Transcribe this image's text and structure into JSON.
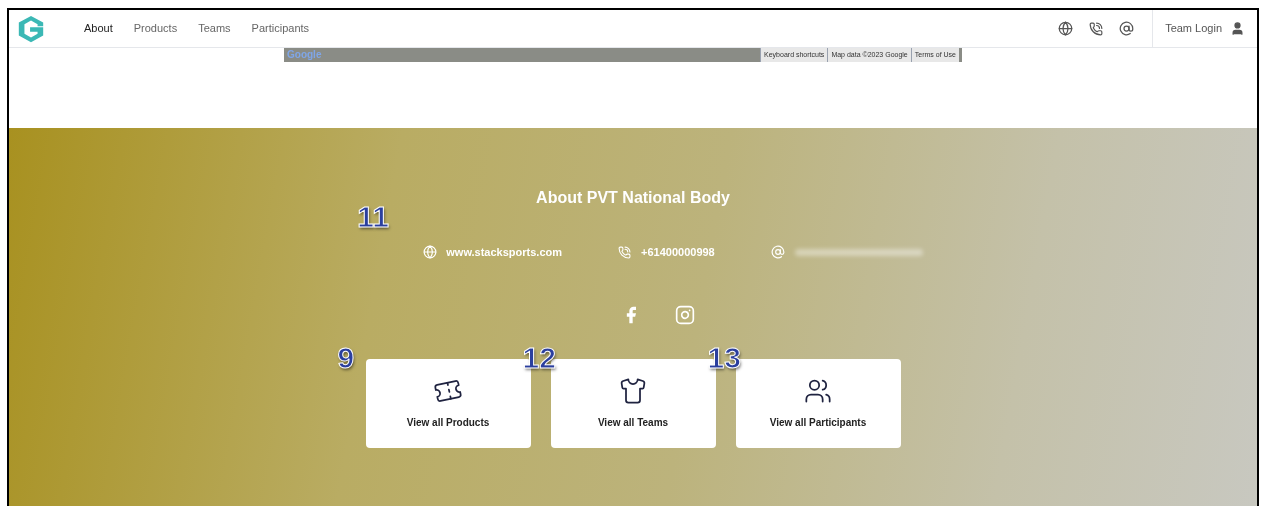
{
  "nav": {
    "links": [
      {
        "label": "About",
        "selected": true
      },
      {
        "label": "Products",
        "selected": false
      },
      {
        "label": "Teams",
        "selected": false
      },
      {
        "label": "Participants",
        "selected": false
      }
    ],
    "login": "Team Login"
  },
  "map": {
    "logo": "Google",
    "attributions": [
      "Keyboard shortcuts",
      "Map data ©2023 Google",
      "Terms of Use"
    ]
  },
  "about": {
    "title": "About PVT National Body",
    "website": "www.stacksports.com",
    "phone": "+61400000998",
    "cards": [
      {
        "kind": "products",
        "label": "View all Products",
        "callout": "9"
      },
      {
        "kind": "teams",
        "label": "View all Teams",
        "callout": "12"
      },
      {
        "kind": "participants",
        "label": "View all Participants",
        "callout": "13"
      }
    ],
    "contact_callout": "11"
  }
}
